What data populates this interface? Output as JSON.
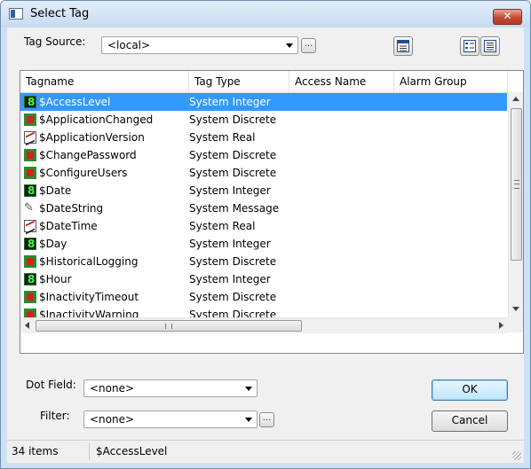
{
  "window": {
    "title": "Select Tag",
    "close_glyph": "✕"
  },
  "tag_source": {
    "label": "Tag Source:",
    "value": "<local>",
    "browse_label": "..."
  },
  "toolbar": {
    "icons": [
      "properties-icon",
      "details-view-icon",
      "list-view-icon"
    ]
  },
  "list": {
    "columns": [
      "Tagname",
      "Tag Type",
      "Access Name",
      "Alarm Group"
    ],
    "rows": [
      {
        "name": "$AccessLevel",
        "type": "System Integer",
        "icon": "integer"
      },
      {
        "name": "$ApplicationChanged",
        "type": "System Discrete",
        "icon": "discrete"
      },
      {
        "name": "$ApplicationVersion",
        "type": "System Real",
        "icon": "real"
      },
      {
        "name": "$ChangePassword",
        "type": "System Discrete",
        "icon": "discrete"
      },
      {
        "name": "$ConfigureUsers",
        "type": "System Discrete",
        "icon": "discrete"
      },
      {
        "name": "$Date",
        "type": "System Integer",
        "icon": "integer"
      },
      {
        "name": "$DateString",
        "type": "System Message",
        "icon": "message"
      },
      {
        "name": "$DateTime",
        "type": "System Real",
        "icon": "real"
      },
      {
        "name": "$Day",
        "type": "System Integer",
        "icon": "integer"
      },
      {
        "name": "$HistoricalLogging",
        "type": "System Discrete",
        "icon": "discrete"
      },
      {
        "name": "$Hour",
        "type": "System Integer",
        "icon": "integer"
      },
      {
        "name": "$InactivityTimeout",
        "type": "System Discrete",
        "icon": "discrete"
      },
      {
        "name": "$InactivityWarning",
        "type": "System Discrete",
        "icon": "discrete"
      }
    ],
    "selected_index": 0,
    "hscroll_glyph": "III"
  },
  "dot_field": {
    "label": "Dot Field:",
    "value": "<none>"
  },
  "filter": {
    "label": "Filter:",
    "value": "<none>",
    "browse_label": "..."
  },
  "buttons": {
    "ok": "OK",
    "cancel": "Cancel"
  },
  "status": {
    "count": "34 items",
    "selected": "$AccessLevel"
  },
  "colors": {
    "selection": "#3399ff",
    "title_gradient": "#c7dbf1",
    "close_button": "#c44a34"
  }
}
